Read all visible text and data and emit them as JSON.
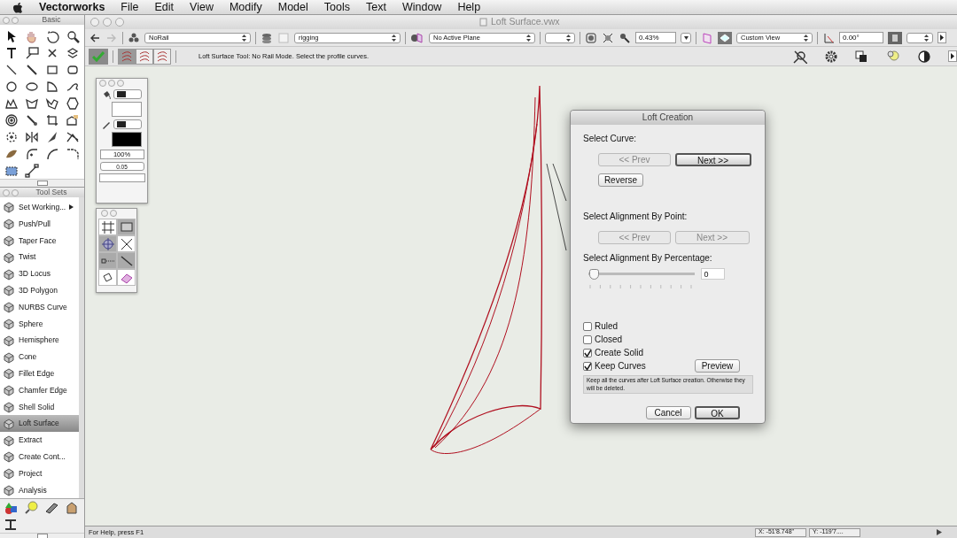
{
  "menu_bar": {
    "app": "Vectorworks",
    "items": [
      "File",
      "Edit",
      "View",
      "Modify",
      "Model",
      "Tools",
      "Text",
      "Window",
      "Help"
    ]
  },
  "basic_palette": {
    "title": "Basic"
  },
  "tool_sets": {
    "title": "Tool Sets",
    "items": [
      {
        "label": "Set Working...",
        "selected": false,
        "submenu": true
      },
      {
        "label": "Push/Pull",
        "selected": false
      },
      {
        "label": "Taper Face",
        "selected": false
      },
      {
        "label": "Twist",
        "selected": false
      },
      {
        "label": "3D Locus",
        "selected": false
      },
      {
        "label": "3D Polygon",
        "selected": false
      },
      {
        "label": "NURBS Curve",
        "selected": false
      },
      {
        "label": "Sphere",
        "selected": false
      },
      {
        "label": "Hemisphere",
        "selected": false
      },
      {
        "label": "Cone",
        "selected": false
      },
      {
        "label": "Fillet Edge",
        "selected": false
      },
      {
        "label": "Chamfer Edge",
        "selected": false
      },
      {
        "label": "Shell Solid",
        "selected": false
      },
      {
        "label": "Loft Surface",
        "selected": true
      },
      {
        "label": "Extract",
        "selected": false
      },
      {
        "label": "Create Cont...",
        "selected": false
      },
      {
        "label": "Project",
        "selected": false
      },
      {
        "label": "Analysis",
        "selected": false
      }
    ]
  },
  "attributes_palette": {
    "opacity": "100%",
    "line_weight": "0.05"
  },
  "document": {
    "title": "Loft Surface.vwx"
  },
  "view_bar": {
    "class": "NoRail",
    "layer": "rigging",
    "plane": "No Active Plane",
    "zoom": "0.43%",
    "view": "Custom View",
    "angle": "0.00°"
  },
  "mode_bar": {
    "modes": [
      {
        "selected": true
      },
      {
        "selected": false
      },
      {
        "selected": false
      }
    ],
    "message": "Loft Surface Tool: No Rail Mode. Select the profile curves."
  },
  "dialog": {
    "title": "Loft Creation",
    "select_curve": {
      "label": "Select Curve:",
      "prev": {
        "label": "<< Prev",
        "disabled": true,
        "default": false
      },
      "next": {
        "label": "Next >>",
        "disabled": false,
        "default": true
      },
      "reverse": {
        "label": "Reverse",
        "disabled": false,
        "default": false
      }
    },
    "alignment_point": {
      "label": "Select Alignment By Point:",
      "prev": {
        "label": "<< Prev",
        "disabled": true,
        "default": false
      },
      "next": {
        "label": "Next >>",
        "disabled": true,
        "default": false
      }
    },
    "alignment_percentage": {
      "label": "Select Alignment By Percentage:",
      "level": 0,
      "value": "0"
    },
    "options": [
      {
        "label": "Ruled",
        "checked": false
      },
      {
        "label": "Closed",
        "checked": false
      },
      {
        "label": "Create Solid",
        "checked": true
      },
      {
        "label": "Keep Curves",
        "checked": true
      }
    ],
    "preview": {
      "label": "Preview",
      "disabled": false,
      "default": false
    },
    "hint": "Keep all the curves after Loft Surface creation. Otherwise they will be deleted.",
    "cancel": {
      "label": "Cancel",
      "disabled": false,
      "default": false
    },
    "ok": {
      "label": "OK",
      "disabled": false,
      "default": true
    }
  },
  "status_bar": {
    "help": "For Help, press F1",
    "x": "X:  -51'8.748\"",
    "y": "Y:  -119'7...."
  }
}
